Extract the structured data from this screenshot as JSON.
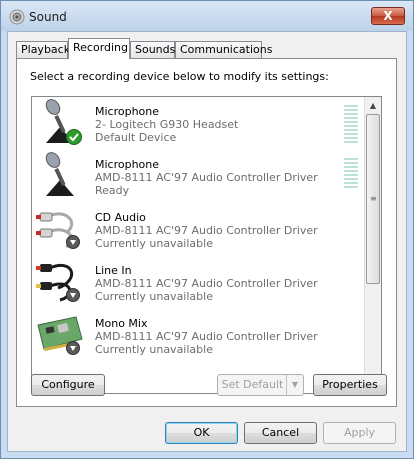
{
  "window": {
    "title": "Sound",
    "close_label": "X"
  },
  "tabs": [
    {
      "label": "Playback"
    },
    {
      "label": "Recording"
    },
    {
      "label": "Sounds"
    },
    {
      "label": "Communications"
    }
  ],
  "active_tab": "Recording",
  "instructions": "Select a recording device below to modify its settings:",
  "devices": [
    {
      "name": "Microphone",
      "line2": "2- Logitech G930 Headset",
      "line3": "Default Device",
      "icon": "microphone-icon",
      "badge": "default-check-icon"
    },
    {
      "name": "Microphone",
      "line2": "AMD-8111 AC'97 Audio Controller Driver",
      "line3": "Ready",
      "icon": "microphone-icon",
      "badge": ""
    },
    {
      "name": "CD Audio",
      "line2": "AMD-8111 AC'97 Audio Controller Driver",
      "line3": "Currently unavailable",
      "icon": "rca-cable-icon",
      "badge": "unavailable-icon"
    },
    {
      "name": "Line In",
      "line2": "AMD-8111 AC'97 Audio Controller Driver",
      "line3": "Currently unavailable",
      "icon": "audio-jack-cable-icon",
      "badge": "unavailable-icon"
    },
    {
      "name": "Mono Mix",
      "line2": "AMD-8111 AC'97 Audio Controller Driver",
      "line3": "Currently unavailable",
      "icon": "sound-card-icon",
      "badge": "unavailable-icon"
    }
  ],
  "buttons": {
    "configure": "Configure",
    "set_default": "Set Default",
    "properties": "Properties",
    "ok": "OK",
    "cancel": "Cancel",
    "apply": "Apply"
  },
  "colors": {
    "titlebar": "#bcd2ea",
    "close": "#c75a40",
    "ok_border": "#3c7fb1",
    "check": "#2e9a2e"
  }
}
